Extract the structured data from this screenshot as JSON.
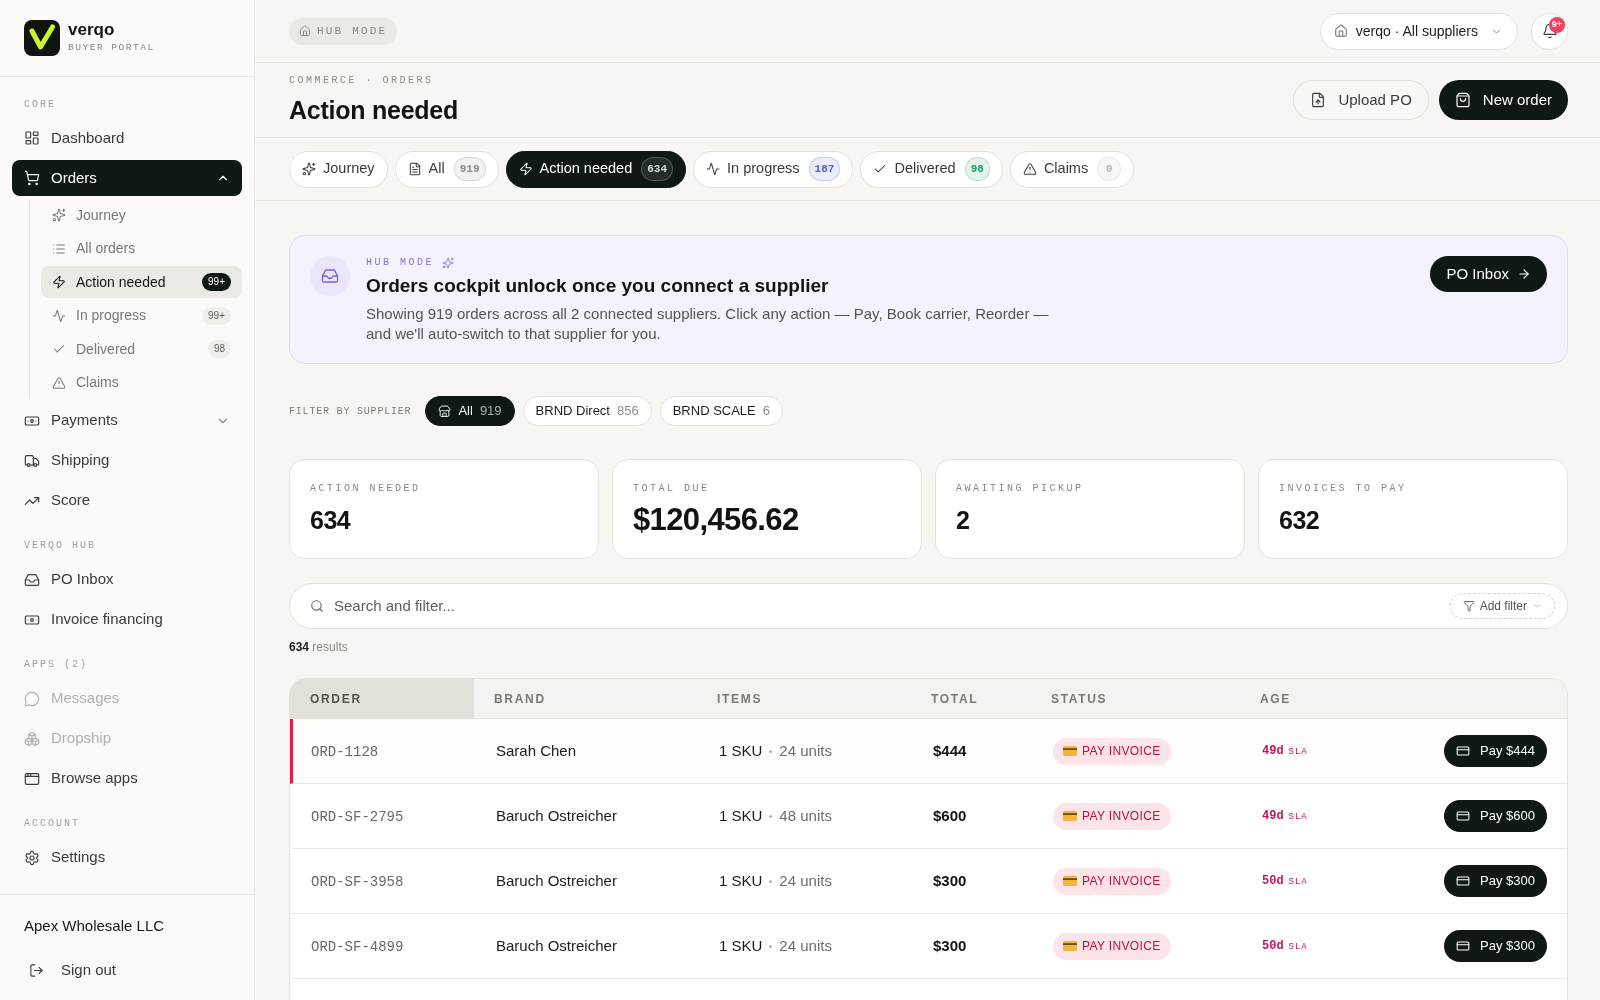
{
  "sidebar": {
    "logo": {
      "name": "verqo",
      "subtitle": "BUYER PORTAL"
    },
    "sections": [
      {
        "label": "CORE",
        "items": [
          {
            "label": "Dashboard",
            "selected": false
          },
          {
            "label": "Orders",
            "selected": true,
            "expanded": true,
            "children": [
              {
                "label": "Journey",
                "selected": false
              },
              {
                "label": "All orders",
                "selected": false
              },
              {
                "label": "Action needed",
                "selected": true,
                "count": "99+"
              },
              {
                "label": "In progress",
                "selected": false,
                "count": "99+"
              },
              {
                "label": "Delivered",
                "selected": false,
                "count": "98"
              },
              {
                "label": "Claims",
                "selected": false
              }
            ]
          },
          {
            "label": "Payments",
            "selected": false,
            "expanded": false
          },
          {
            "label": "Shipping",
            "selected": false
          },
          {
            "label": "Score",
            "selected": false
          }
        ]
      },
      {
        "label": "VERQO HUB",
        "items": [
          {
            "label": "PO Inbox",
            "selected": false
          },
          {
            "label": "Invoice financing",
            "selected": false
          }
        ]
      },
      {
        "label": "APPS (2)",
        "items": [
          {
            "label": "Messages",
            "selected": false,
            "disabled": true
          },
          {
            "label": "Dropship",
            "selected": false,
            "disabled": true
          },
          {
            "label": "Browse apps",
            "selected": false,
            "disabled": false
          }
        ]
      },
      {
        "label": "ACCOUNT",
        "items": [
          {
            "label": "Settings",
            "selected": false
          }
        ]
      }
    ],
    "footer": {
      "company": "Apex Wholesale LLC",
      "sign_out": "Sign out"
    }
  },
  "top_bar": {
    "mode_badge": "HUB MODE",
    "supplier_select": "verqo · All suppliers",
    "notification_count": "9+"
  },
  "header": {
    "breadcrumb": "COMMERCE · ORDERS",
    "title": "Action needed",
    "upload_button": "Upload PO",
    "new_order_button": "New order"
  },
  "tabs": [
    {
      "label": "Journey",
      "selected": false
    },
    {
      "label": "All",
      "count": "919",
      "color": "#8c8a84",
      "selected": false
    },
    {
      "label": "Action needed",
      "count": "634",
      "color": "#d9dbd9",
      "selected": true
    },
    {
      "label": "In progress",
      "count": "187",
      "color": "#4f5fd6",
      "selected": false
    },
    {
      "label": "Delivered",
      "count": "98",
      "color": "#1f9d63",
      "selected": false
    },
    {
      "label": "Claims",
      "count": "0",
      "color": "#b9b7b1",
      "selected": false
    }
  ],
  "banner": {
    "label": "HUB MODE",
    "title": "Orders cockpit unlock once you connect a supplier",
    "text": "Showing 919 orders across all 2 connected suppliers. Click any action — Pay, Book carrier, Reorder — and we'll auto-switch to that supplier for you.",
    "button": "PO Inbox"
  },
  "supplier_filter": {
    "label": "FILTER BY SUPPLIER",
    "chips": [
      {
        "label": "All",
        "count": "919",
        "selected": true
      },
      {
        "label": "BRND Direct",
        "count": "856",
        "selected": false
      },
      {
        "label": "BRND SCALE",
        "count": "6",
        "selected": false
      }
    ]
  },
  "stats": [
    {
      "label": "ACTION NEEDED",
      "value": "634",
      "kind": "count"
    },
    {
      "label": "TOTAL DUE",
      "value": "$120,456.62",
      "kind": "amount"
    },
    {
      "label": "AWAITING PICKUP",
      "value": "2",
      "kind": "count"
    },
    {
      "label": "INVOICES TO PAY",
      "value": "632",
      "kind": "count"
    }
  ],
  "search": {
    "placeholder": "Search and filter...",
    "filter_button": "Add filter"
  },
  "results": "**634** results",
  "table": {
    "columns": [
      {
        "label": "ORDER",
        "sorted": true
      },
      {
        "label": "BRAND",
        "sorted": false
      },
      {
        "label": "ITEMS",
        "sorted": false
      },
      {
        "label": "TOTAL",
        "sorted": false
      },
      {
        "label": "STATUS",
        "sorted": false
      },
      {
        "label": "AGE",
        "sorted": false
      }
    ],
    "rows": [
      {
        "order": "ORD-1128",
        "brand": "Sarah Chen",
        "items": "1 SKU",
        "units": "24 units",
        "total": "$444",
        "status": "PAY INVOICE",
        "age": "49d",
        "sla": "SLA",
        "action": "Pay $444",
        "selected": true
      },
      {
        "order": "ORD-SF-2795",
        "brand": "Baruch Ostreicher",
        "items": "1 SKU",
        "units": "48 units",
        "total": "$600",
        "status": "PAY INVOICE",
        "age": "49d",
        "sla": "SLA",
        "action": "Pay $600",
        "selected": false
      },
      {
        "order": "ORD-SF-3958",
        "brand": "Baruch Ostreicher",
        "items": "1 SKU",
        "units": "24 units",
        "total": "$300",
        "status": "PAY INVOICE",
        "age": "50d",
        "sla": "SLA",
        "action": "Pay $300",
        "selected": false
      },
      {
        "order": "ORD-SF-4899",
        "brand": "Baruch Ostreicher",
        "items": "1 SKU",
        "units": "24 units",
        "total": "$300",
        "status": "PAY INVOICE",
        "age": "50d",
        "sla": "SLA",
        "action": "Pay $300",
        "selected": false
      }
    ]
  }
}
